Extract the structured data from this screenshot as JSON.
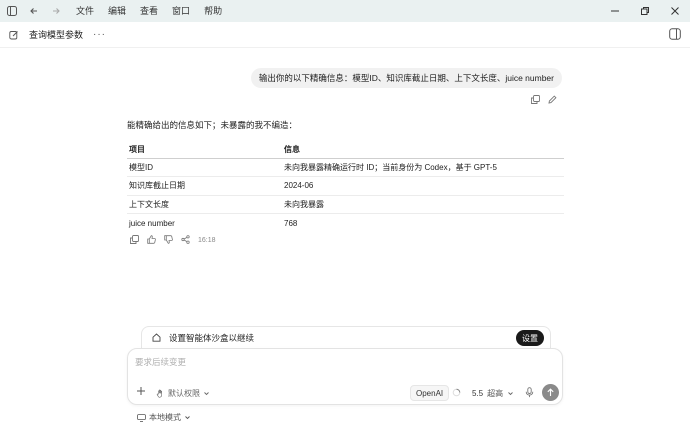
{
  "menu": {
    "items": [
      "文件",
      "编辑",
      "查看",
      "窗口",
      "帮助"
    ]
  },
  "header": {
    "title": "查询模型参数",
    "more": "···"
  },
  "user_message": {
    "text": "输出你的以下精确信息：模型ID、知识库截止日期、上下文长度、juice number"
  },
  "assistant": {
    "intro": "能精确给出的信息如下；未暴露的我不编造：",
    "table": {
      "headers": [
        "项目",
        "信息"
      ],
      "rows": [
        [
          "模型ID",
          "未向我暴露精确运行时 ID；当前身份为 Codex，基于 GPT-5"
        ],
        [
          "知识库截止日期",
          "2024-06"
        ],
        [
          "上下文长度",
          "未向我暴露"
        ],
        [
          "juice number",
          "768"
        ]
      ]
    },
    "time": "16:18"
  },
  "sandbox": {
    "label": "设置智能体沙盒以继续",
    "button": "设置"
  },
  "composer": {
    "placeholder": "要求后续变更",
    "permission": "默认权限",
    "provider": "OpenAI",
    "model": "5.5",
    "mode": "超高"
  },
  "footer": {
    "local_mode": "本地模式"
  },
  "colors": {
    "titlebar_bg": "#eaf1f1",
    "send_button": "#8a8a8a",
    "sandbox_button": "#1a1a1a"
  }
}
